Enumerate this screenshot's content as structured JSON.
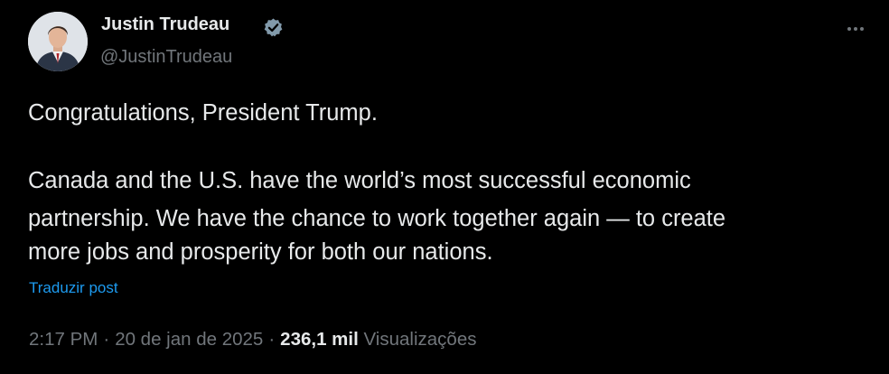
{
  "author": {
    "name": "Justin Trudeau",
    "handle": "@JustinTrudeau",
    "verified": true,
    "verified_color": "#829aab"
  },
  "tweet": {
    "lines": [
      "Congratulations, President Trump.",
      "Canada and the U.S. have the world’s most successful economic",
      "partnership. We have the chance to work together again — to create",
      "more jobs and prosperity for both our nations."
    ],
    "translate_label": "Traduzir post"
  },
  "meta": {
    "time": "2:17 PM",
    "separator": "·",
    "date": "20 de jan de 2025",
    "views_count": "236,1 mil",
    "views_label": "Visualizações"
  },
  "colors": {
    "background": "#000000",
    "text_primary": "#e7e9ea",
    "text_secondary": "#71767b",
    "link": "#1d9bf0"
  },
  "icons": {
    "more": "more-horizontal-icon",
    "verified": "verified-badge-icon"
  }
}
